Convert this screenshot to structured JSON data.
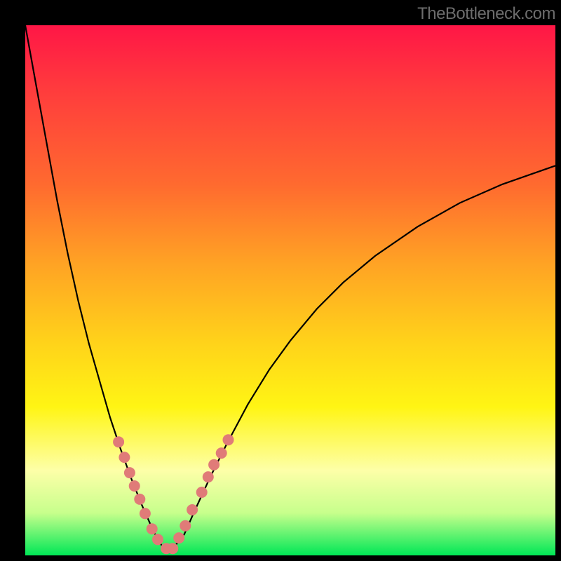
{
  "watermark": "TheBottleneck.com",
  "chart_data": {
    "type": "line",
    "title": "",
    "xlabel": "",
    "ylabel": "",
    "xlim": [
      0,
      100
    ],
    "ylim": [
      0,
      100
    ],
    "background_gradient": {
      "direction": "vertical",
      "stops": [
        {
          "pos": 0,
          "color": "#ff1646"
        },
        {
          "pos": 12,
          "color": "#ff3b3d"
        },
        {
          "pos": 30,
          "color": "#ff6a2f"
        },
        {
          "pos": 45,
          "color": "#ffa324"
        },
        {
          "pos": 60,
          "color": "#ffd31a"
        },
        {
          "pos": 72,
          "color": "#fff514"
        },
        {
          "pos": 84,
          "color": "#fdffa8"
        },
        {
          "pos": 92,
          "color": "#c7ff8c"
        },
        {
          "pos": 100,
          "color": "#00e756"
        }
      ]
    },
    "series": [
      {
        "name": "bottleneck-curve",
        "color": "#000000",
        "x": [
          0.0,
          2.0,
          4.0,
          6.0,
          8.0,
          10.0,
          12.0,
          14.0,
          16.0,
          18.0,
          20.0,
          22.0,
          24.0,
          25.0,
          26.0,
          27.0,
          28.0,
          30.0,
          32.0,
          35.0,
          38.0,
          42.0,
          46.0,
          50.0,
          55.0,
          60.0,
          66.0,
          74.0,
          82.0,
          90.0,
          100.0
        ],
        "y": [
          100.0,
          89.0,
          78.0,
          67.0,
          57.0,
          48.0,
          40.0,
          33.0,
          26.0,
          20.0,
          14.5,
          9.5,
          5.0,
          3.0,
          1.5,
          1.0,
          1.5,
          4.0,
          8.5,
          15.0,
          21.0,
          28.5,
          35.0,
          40.5,
          46.5,
          51.5,
          56.5,
          62.0,
          66.5,
          70.0,
          73.5
        ]
      },
      {
        "name": "marker-dots",
        "type": "scatter",
        "color": "#e07b78",
        "x": [
          17.6,
          18.7,
          19.7,
          20.6,
          21.6,
          22.6,
          23.9,
          25.0,
          26.6,
          27.8,
          29.0,
          30.2,
          31.5,
          33.3,
          34.5,
          35.6,
          37.0,
          38.3
        ],
        "y": [
          21.4,
          18.5,
          15.6,
          13.1,
          10.6,
          7.9,
          5.0,
          3.0,
          1.3,
          1.3,
          3.3,
          5.6,
          8.6,
          11.9,
          14.8,
          17.1,
          19.3,
          21.8
        ]
      }
    ]
  }
}
